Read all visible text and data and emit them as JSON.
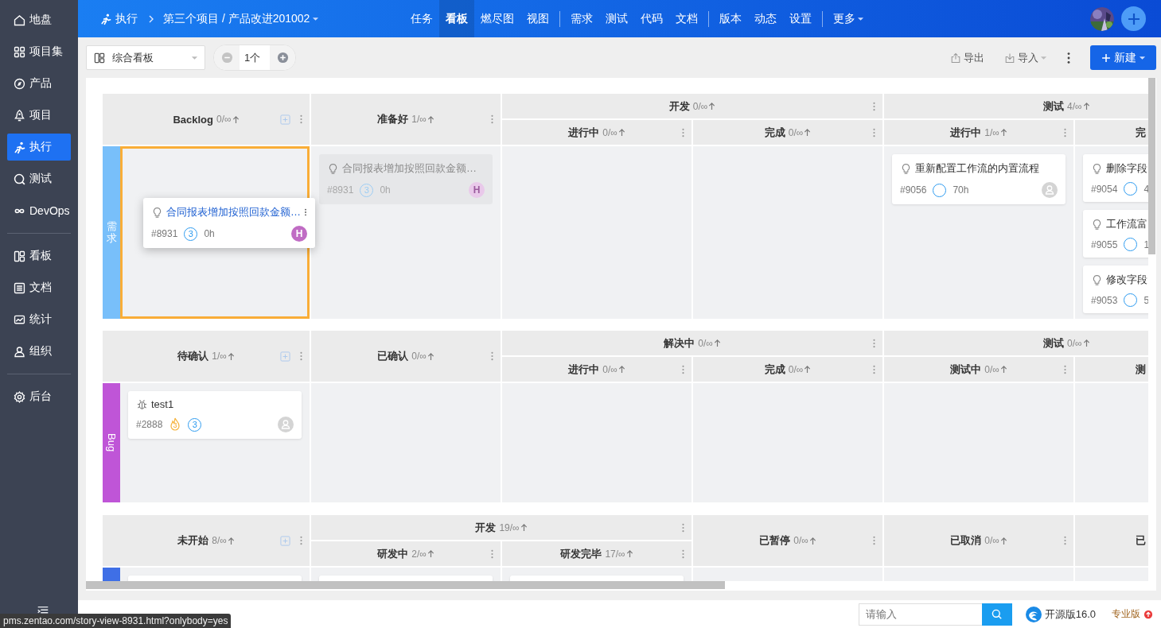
{
  "sidebar": {
    "groups": [
      [
        {
          "label": "地盘",
          "selected": false
        },
        {
          "label": "项目集",
          "selected": false
        },
        {
          "label": "产品",
          "selected": false
        },
        {
          "label": "项目",
          "selected": false
        },
        {
          "label": "执行",
          "selected": true
        },
        {
          "label": "测试",
          "selected": false
        },
        {
          "label": "DevOps",
          "selected": false
        }
      ],
      [
        {
          "label": "看板",
          "selected": false
        },
        {
          "label": "文档",
          "selected": false
        },
        {
          "label": "统计",
          "selected": false
        },
        {
          "label": "组织",
          "selected": false
        }
      ],
      [
        {
          "label": "后台",
          "selected": false
        }
      ]
    ]
  },
  "breadcrumb": {
    "module": "执行",
    "project": "第三个项目 / 产品改进201002"
  },
  "nav": {
    "groups": [
      [
        {
          "label": "任务",
          "selected": false
        },
        {
          "label": "看板",
          "selected": true
        },
        {
          "label": "燃尽图",
          "selected": false
        },
        {
          "label": "视图",
          "selected": false
        }
      ],
      [
        {
          "label": "需求",
          "selected": false
        },
        {
          "label": "测试",
          "selected": false
        },
        {
          "label": "代码",
          "selected": false
        },
        {
          "label": "文档",
          "selected": false
        }
      ],
      [
        {
          "label": "版本",
          "selected": false
        },
        {
          "label": "动态",
          "selected": false
        },
        {
          "label": "设置",
          "selected": false
        }
      ]
    ],
    "more": "更多"
  },
  "toolbar": {
    "board_select": "综合看板",
    "count": "1个",
    "export": "导出",
    "import": "导入",
    "create": "新建"
  },
  "regions": [
    {
      "lane": {
        "label": "需求",
        "kind": "stacked",
        "color": "#78bffa"
      },
      "columns": [
        {
          "title": "Backlog",
          "count": "0/∞"
        },
        {
          "title": "准备好",
          "count": "1/∞"
        },
        {
          "title": "开发",
          "count": "0/∞",
          "children": [
            {
              "title": "进行中",
              "count": "0/∞"
            },
            {
              "title": "完成",
              "count": "0/∞"
            }
          ]
        },
        {
          "title": "测试",
          "count": "4/∞",
          "children": [
            {
              "title": "进行中",
              "count": "1/∞"
            },
            {
              "title": "完"
            }
          ]
        }
      ],
      "cells": [
        {
          "drop_target": true,
          "cards": [
            {
              "kind": "story",
              "dragging": true,
              "placeholder": false,
              "title": "合同报表增加按照回款金额…",
              "number": "#8931",
              "pri": "3",
              "hours": "0h",
              "avatar": {
                "kind": "initial",
                "initial": "H",
                "color": "#c06cc4"
              }
            }
          ]
        },
        {
          "drop_target": false,
          "cards": [
            {
              "kind": "story",
              "dragging": false,
              "placeholder": true,
              "title": "合同报表增加按照回款金额…",
              "number": "#8931",
              "pri": "3",
              "hours": "0h",
              "avatar": {
                "kind": "initial",
                "initial": "H",
                "color": "#e9c9ea"
              }
            }
          ]
        },
        {
          "drop_target": false
        },
        {
          "drop_target": false
        },
        {
          "drop_target": false,
          "cards": [
            {
              "kind": "story",
              "dragging": false,
              "placeholder": false,
              "title": "重新配置工作流的内置流程",
              "number": "#9056",
              "hours": "70h",
              "avatar": {
                "kind": "default"
              }
            }
          ]
        },
        {
          "drop_target": false,
          "cards": [
            {
              "kind": "story",
              "dragging": false,
              "placeholder": false,
              "title": "删除字段",
              "number": "#9054",
              "hours": "4"
            },
            {
              "kind": "story",
              "dragging": false,
              "placeholder": false,
              "title": "工作流富",
              "number": "#9055",
              "hours": "1"
            },
            {
              "kind": "story",
              "dragging": false,
              "placeholder": false,
              "title": "修改字段",
              "number": "#9053",
              "hours": "5"
            }
          ]
        }
      ]
    },
    {
      "lane": {
        "label": "Bug",
        "kind": "rotated",
        "color": "#bf55d7"
      },
      "columns": [
        {
          "title": "待确认",
          "count": "1/∞"
        },
        {
          "title": "已确认",
          "count": "0/∞"
        },
        {
          "title": "解决中",
          "count": "0/∞",
          "children": [
            {
              "title": "进行中",
              "count": "0/∞"
            },
            {
              "title": "完成",
              "count": "0/∞"
            }
          ]
        },
        {
          "title": "测试",
          "count": "0/∞",
          "children": [
            {
              "title": "测试中",
              "count": "0/∞"
            },
            {
              "title": "测"
            }
          ]
        }
      ],
      "cells": [
        {
          "drop_target": false,
          "cards": [
            {
              "kind": "bug",
              "dragging": false,
              "placeholder": false,
              "title": "test1",
              "number": "#2888",
              "severity": "3",
              "pri": "3",
              "avatar": {
                "kind": "default"
              }
            }
          ]
        },
        {
          "drop_target": false
        },
        {
          "drop_target": false
        },
        {
          "drop_target": false
        },
        {
          "drop_target": false
        },
        {
          "drop_target": false
        }
      ]
    },
    {
      "lane": {
        "color": "#3f6fe6"
      },
      "columns": [
        {
          "title": "未开始",
          "count": "8/∞"
        },
        {
          "title": "开发",
          "count": "19/∞",
          "children": [
            {
              "title": "研发中",
              "count": "2/∞"
            },
            {
              "title": "研发完毕",
              "count": "17/∞"
            }
          ]
        },
        {
          "title": "已暂停",
          "count": "0/∞"
        },
        {
          "title": "已取消",
          "count": "0/∞"
        },
        {
          "title": "已"
        }
      ],
      "cells": [
        {
          "drop_target": false,
          "cards": [
            {
              "kind": "story",
              "dragging": false,
              "placeholder": false
            }
          ]
        },
        {
          "drop_target": false,
          "cards": [
            {
              "kind": "story",
              "dragging": false,
              "placeholder": false
            }
          ]
        },
        {
          "drop_target": false,
          "cards": [
            {
              "kind": "story",
              "dragging": false,
              "placeholder": false
            }
          ]
        },
        {
          "drop_target": false
        },
        {
          "drop_target": false
        },
        {
          "drop_target": false
        }
      ]
    }
  ],
  "footer": {
    "search_placeholder": "请输入",
    "edition": "开源版16.0",
    "pro": "专业版"
  },
  "status_tooltip": "pms.zentao.com/story-view-8931.html?onlybody=yes"
}
